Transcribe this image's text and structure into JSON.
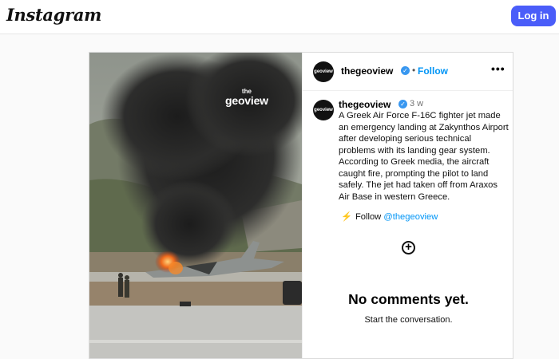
{
  "header": {
    "logo": "Instagram",
    "login_label": "Log in"
  },
  "post": {
    "image_alt": "Smoke and fire rising from a fighter jet on an airport runway",
    "watermark_top": "the",
    "watermark_main": "geoview",
    "author": {
      "username": "thegeoview",
      "avatar_text": "geoview",
      "verified_mark": "✓"
    },
    "header_dot": "•",
    "follow_label": "Follow",
    "more_label": "•••",
    "time_ago": "3 w",
    "caption": "A Greek Air Force F-16C fighter jet made an emergency landing at Zakynthos Airport after developing serious technical problems with its landing gear system. According to Greek media, the aircraft caught fire, prompting the pilot to land safely. The jet had taken off from Araxos Air Base in western Greece.",
    "cta": {
      "bolt": "⚡",
      "text": "Follow",
      "handle": "@thegeoview"
    },
    "add_comment_icon": "+",
    "comments_empty_title": "No comments yet.",
    "comments_empty_subtitle": "Start the conversation."
  },
  "colors": {
    "accent": "#4a5df9",
    "link": "#0095f6",
    "verified": "#3897f0"
  },
  "icons": [
    "verified-badge-icon",
    "more-options-icon",
    "lightning-icon",
    "add-comment-icon"
  ]
}
